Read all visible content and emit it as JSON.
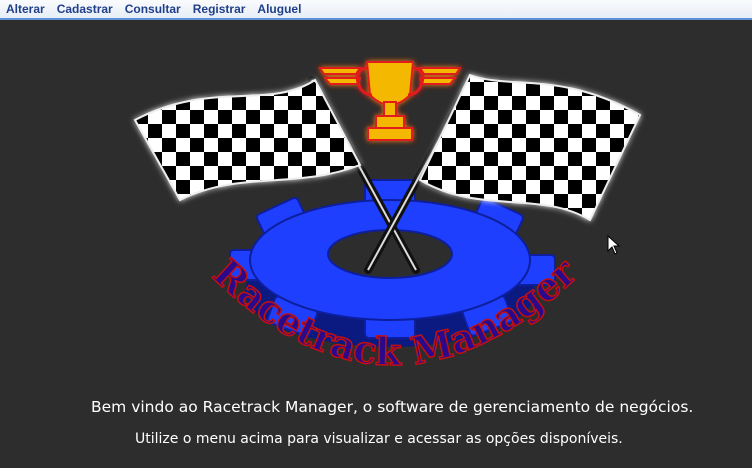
{
  "menu": {
    "items": [
      {
        "label": "Alterar"
      },
      {
        "label": "Cadastrar"
      },
      {
        "label": "Consultar"
      },
      {
        "label": "Registrar"
      },
      {
        "label": "Aluguel"
      }
    ]
  },
  "logo": {
    "text": "Racetrack Manager",
    "colors": {
      "gear": "#1f3fff",
      "trophy": "#f5b800",
      "trophy_outline": "#e01a1a",
      "text": "#2a0a8a",
      "text_outline": "#c21010"
    }
  },
  "main": {
    "welcome": "Bem vindo ao Racetrack Manager, o software de gerenciamento de negócios.",
    "hint": "Utilize o menu acima para visualizar e acessar as opções disponíveis."
  },
  "colors": {
    "background": "#2d2d2d",
    "menu_text": "#1f3f8a",
    "menu_border": "#5b8fd6"
  }
}
